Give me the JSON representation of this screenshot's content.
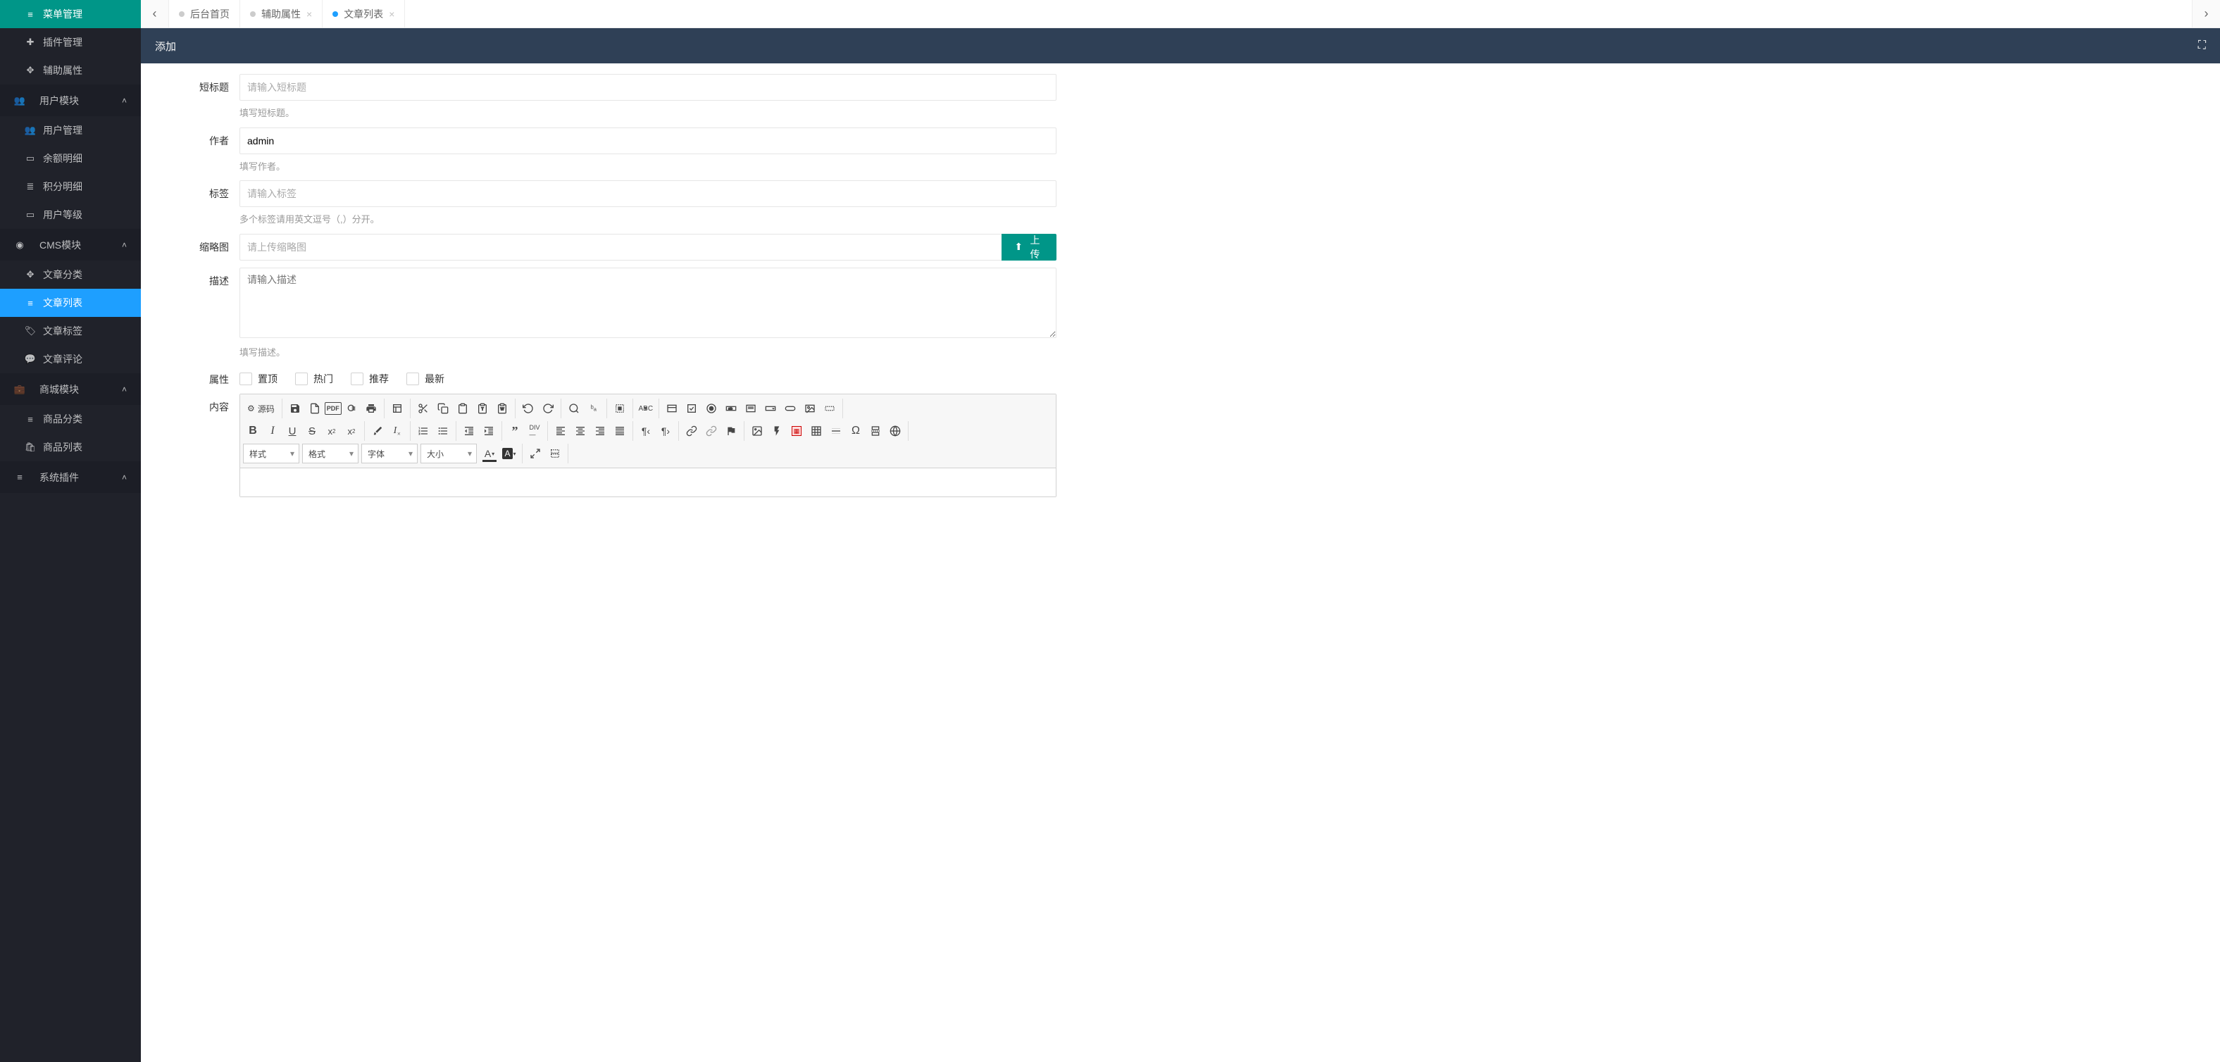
{
  "sidebar": {
    "top_items": [
      {
        "icon": "list",
        "label": "菜单管理"
      },
      {
        "icon": "plus-square",
        "label": "插件管理"
      },
      {
        "icon": "arrows",
        "label": "辅助属性"
      }
    ],
    "sections": [
      {
        "icon": "users",
        "label": "用户模块",
        "items": [
          {
            "icon": "users",
            "label": "用户管理"
          },
          {
            "icon": "money",
            "label": "余额明细"
          },
          {
            "icon": "database",
            "label": "积分明细"
          },
          {
            "icon": "id-card",
            "label": "用户等级"
          }
        ]
      },
      {
        "icon": "compass",
        "label": "CMS模块",
        "items": [
          {
            "icon": "arrows",
            "label": "文章分类"
          },
          {
            "icon": "list",
            "label": "文章列表",
            "active": true
          },
          {
            "icon": "tag",
            "label": "文章标签"
          },
          {
            "icon": "comment",
            "label": "文章评论"
          }
        ]
      },
      {
        "icon": "briefcase",
        "label": "商城模块",
        "items": [
          {
            "icon": "list",
            "label": "商品分类"
          },
          {
            "icon": "bag",
            "label": "商品列表"
          }
        ]
      },
      {
        "icon": "bars",
        "label": "系统插件",
        "items": []
      }
    ]
  },
  "tabs": [
    {
      "label": "后台首页",
      "closable": false,
      "active": false
    },
    {
      "label": "辅助属性",
      "closable": true,
      "active": false
    },
    {
      "label": "文章列表",
      "closable": true,
      "active": true
    }
  ],
  "page": {
    "title": "添加"
  },
  "form": {
    "short_title": {
      "label": "短标题",
      "placeholder": "请输入短标题",
      "help": "填写短标题。"
    },
    "author": {
      "label": "作者",
      "value": "admin",
      "help": "填写作者。"
    },
    "tags": {
      "label": "标签",
      "placeholder": "请输入标签",
      "help": "多个标签请用英文逗号（,）分开。"
    },
    "thumb": {
      "label": "缩略图",
      "placeholder": "请上传缩略图",
      "button": "上传"
    },
    "desc": {
      "label": "描述",
      "placeholder": "请输入描述",
      "help": "填写描述。"
    },
    "attrs": {
      "label": "属性",
      "options": [
        "置顶",
        "热门",
        "推荐",
        "最新"
      ]
    },
    "content": {
      "label": "内容"
    }
  },
  "editor": {
    "source_label": "源码",
    "selects": {
      "style": "样式",
      "format": "格式",
      "font": "字体",
      "size": "大小"
    }
  }
}
